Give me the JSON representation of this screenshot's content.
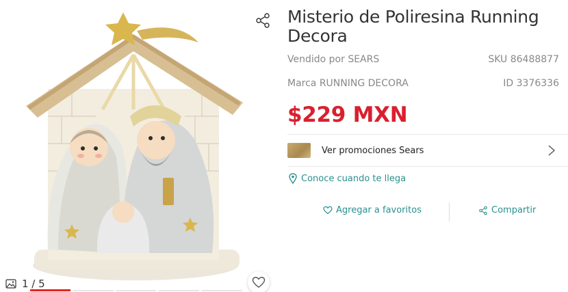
{
  "product": {
    "title": "Misterio de Poliresina Running Decora",
    "seller": "Vendido por SEARS",
    "sku": "SKU 86488877",
    "brand": "Marca RUNNING DECORA",
    "id": "ID 3376336",
    "price": "$229 MXN"
  },
  "gallery": {
    "counter": "1 / 5",
    "total_images": 5,
    "active_index": 1
  },
  "promotions": {
    "label": "Ver promociones Sears"
  },
  "notify": {
    "label": "Conoce cuando te llega"
  },
  "actions": {
    "favorite_label": "Agregar a favoritos",
    "share_label": "Compartir"
  },
  "colors": {
    "price": "#d9202e",
    "link": "#2a8f8f",
    "progress_active": "#e1261c"
  }
}
